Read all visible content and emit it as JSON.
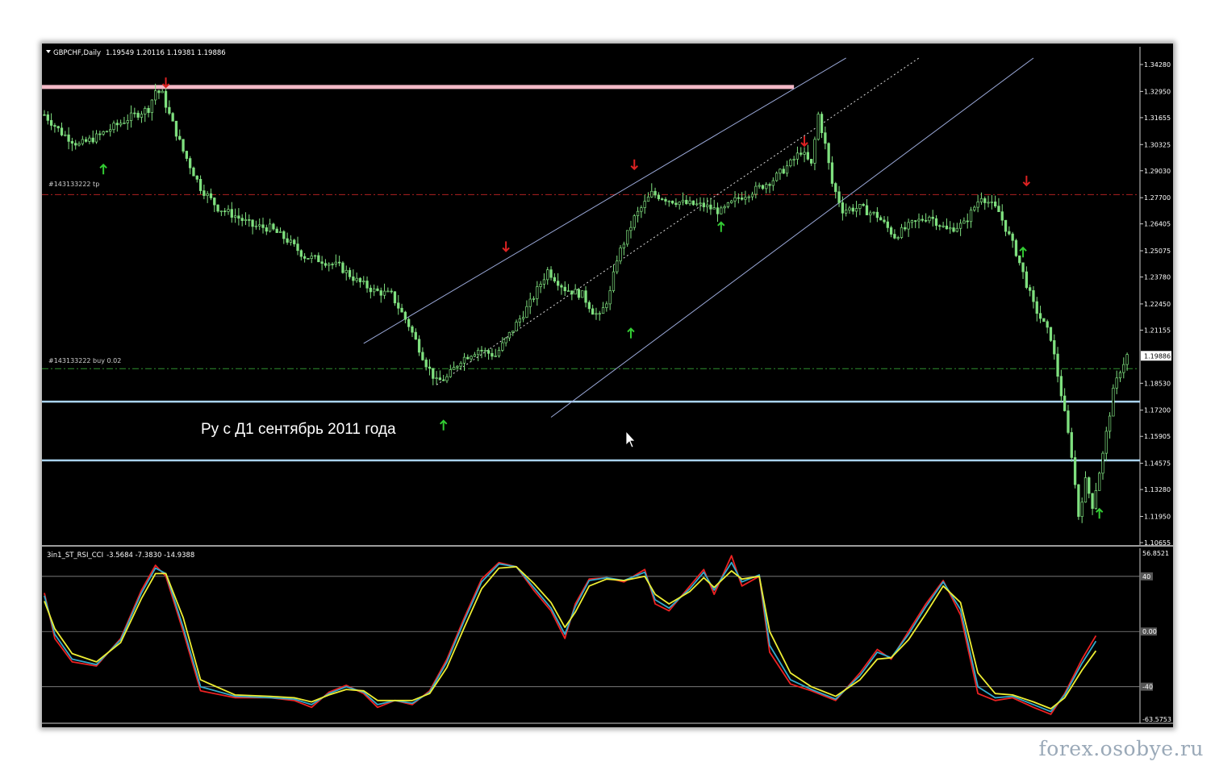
{
  "main_header": {
    "symbol": "GBPCHF,Daily",
    "ohlc": "1.19549 1.20116 1.19381 1.19886"
  },
  "indicator_header": {
    "name": "3in1_ST_RSI_CCI",
    "values": "-3.5684 -7.3830 -14.9388"
  },
  "annotation": "Ру с Д1 сентябрь 2011 года",
  "order_labels": {
    "tp": "#143133222 tp",
    "buy": "#143133222 buy 0.02"
  },
  "watermark": "forex.osobye.ru",
  "colors": {
    "candle": "#7fe07f",
    "resistance": "#f3b8c6",
    "support": "#a9d3f0",
    "channel": "#9aa8d8",
    "tp_line": "#b02020",
    "buy_line": "#2f8f2f",
    "arrow_up": "#33cc33",
    "arrow_down": "#dd2222"
  },
  "chart_data": [
    {
      "type": "line",
      "title": "GBPCHF,Daily",
      "ylim": [
        1.10655,
        1.3428
      ],
      "price_ticks": [
        "1.34280",
        "1.32950",
        "1.31655",
        "1.30325",
        "1.29030",
        "1.27700",
        "1.26405",
        "1.25075",
        "1.23780",
        "1.22450",
        "1.21155",
        "1.19886",
        "1.18530",
        "1.17200",
        "1.15905",
        "1.14575",
        "1.13280",
        "1.11950",
        "1.10655"
      ],
      "current_price": "1.19886",
      "close": [
        [
          0,
          1.318
        ],
        [
          5,
          1.309
        ],
        [
          10,
          1.303
        ],
        [
          15,
          1.307
        ],
        [
          20,
          1.312
        ],
        [
          25,
          1.317
        ],
        [
          30,
          1.321
        ],
        [
          32,
          1.33
        ],
        [
          34,
          1.328
        ],
        [
          36,
          1.318
        ],
        [
          40,
          1.3
        ],
        [
          45,
          1.282
        ],
        [
          50,
          1.272
        ],
        [
          55,
          1.268
        ],
        [
          60,
          1.263
        ],
        [
          65,
          1.262
        ],
        [
          70,
          1.256
        ],
        [
          75,
          1.248
        ],
        [
          80,
          1.246
        ],
        [
          85,
          1.243
        ],
        [
          90,
          1.236
        ],
        [
          95,
          1.231
        ],
        [
          100,
          1.229
        ],
        [
          105,
          1.214
        ],
        [
          110,
          1.195
        ],
        [
          113,
          1.186
        ],
        [
          116,
          1.188
        ],
        [
          120,
          1.197
        ],
        [
          125,
          1.202
        ],
        [
          130,
          1.199
        ],
        [
          135,
          1.212
        ],
        [
          140,
          1.225
        ],
        [
          145,
          1.241
        ],
        [
          150,
          1.232
        ],
        [
          155,
          1.229
        ],
        [
          158,
          1.221
        ],
        [
          160,
          1.218
        ],
        [
          163,
          1.23
        ],
        [
          165,
          1.247
        ],
        [
          170,
          1.267
        ],
        [
          175,
          1.279
        ],
        [
          180,
          1.276
        ],
        [
          185,
          1.274
        ],
        [
          190,
          1.273
        ],
        [
          195,
          1.27
        ],
        [
          200,
          1.277
        ],
        [
          205,
          1.281
        ],
        [
          210,
          1.286
        ],
        [
          215,
          1.294
        ],
        [
          218,
          1.3
        ],
        [
          221,
          1.293
        ],
        [
          223,
          1.318
        ],
        [
          225,
          1.303
        ],
        [
          227,
          1.284
        ],
        [
          230,
          1.271
        ],
        [
          235,
          1.272
        ],
        [
          240,
          1.268
        ],
        [
          245,
          1.258
        ],
        [
          250,
          1.264
        ],
        [
          255,
          1.268
        ],
        [
          260,
          1.261
        ],
        [
          265,
          1.264
        ],
        [
          270,
          1.278
        ],
        [
          275,
          1.27
        ],
        [
          280,
          1.25
        ],
        [
          285,
          1.224
        ],
        [
          290,
          1.208
        ],
        [
          293,
          1.18
        ],
        [
          296,
          1.15
        ],
        [
          298,
          1.12
        ],
        [
          300,
          1.137
        ],
        [
          302,
          1.125
        ],
        [
          305,
          1.15
        ],
        [
          308,
          1.181
        ],
        [
          310,
          1.192
        ],
        [
          312,
          1.199
        ]
      ],
      "resistance": 1.3317,
      "support": [
        1.1762,
        1.1472
      ],
      "tp_level": 1.2785,
      "buy_level": 1.1925,
      "channel": [
        {
          "style": "solid",
          "from": [
            92,
            1.205
          ],
          "to": [
            231,
            1.346
          ]
        },
        {
          "style": "dotted",
          "from": [
            113,
            1.1845
          ],
          "to": [
            252,
            1.346
          ]
        },
        {
          "style": "solid",
          "from": [
            146,
            1.1685
          ],
          "to": [
            285,
            1.346
          ]
        }
      ],
      "up_arrows": [
        [
          17,
          1.2905
        ],
        [
          115,
          1.164
        ],
        [
          195,
          1.262
        ],
        [
          169,
          1.2095
        ],
        [
          282,
          1.2495
        ],
        [
          304,
          1.1204
        ]
      ],
      "down_arrows": [
        [
          35,
          1.334
        ],
        [
          133,
          1.253
        ],
        [
          170,
          1.2935
        ],
        [
          219,
          1.305
        ],
        [
          283,
          1.2855
        ]
      ]
    },
    {
      "type": "line",
      "title": "3in1_ST_RSI_CCI",
      "ylim": [
        -63.5753,
        56.8521
      ],
      "value_ticks": [
        "56.8521",
        "40",
        "0.00",
        "-40",
        "-63.5753"
      ],
      "series": [
        {
          "name": "ST",
          "color": "#ee2222",
          "values": [
            [
              0,
              28
            ],
            [
              3,
              -5
            ],
            [
              8,
              -22
            ],
            [
              15,
              -25
            ],
            [
              22,
              -5
            ],
            [
              28,
              30
            ],
            [
              32,
              48
            ],
            [
              35,
              40
            ],
            [
              40,
              0
            ],
            [
              45,
              -43
            ],
            [
              55,
              -48
            ],
            [
              65,
              -48
            ],
            [
              72,
              -50
            ],
            [
              77,
              -55
            ],
            [
              82,
              -44
            ],
            [
              87,
              -39
            ],
            [
              92,
              -45
            ],
            [
              96,
              -55
            ],
            [
              101,
              -50
            ],
            [
              106,
              -53
            ],
            [
              111,
              -43
            ],
            [
              116,
              -20
            ],
            [
              121,
              10
            ],
            [
              126,
              38
            ],
            [
              131,
              50
            ],
            [
              136,
              47
            ],
            [
              141,
              30
            ],
            [
              146,
              15
            ],
            [
              150,
              -5
            ],
            [
              153,
              20
            ],
            [
              157,
              38
            ],
            [
              162,
              39
            ],
            [
              167,
              36
            ],
            [
              173,
              45
            ],
            [
              176,
              20
            ],
            [
              180,
              15
            ],
            [
              186,
              33
            ],
            [
              190,
              45
            ],
            [
              193,
              27
            ],
            [
              198,
              55
            ],
            [
              201,
              33
            ],
            [
              206,
              40
            ],
            [
              209,
              -15
            ],
            [
              215,
              -38
            ],
            [
              221,
              -43
            ],
            [
              228,
              -50
            ],
            [
              235,
              -30
            ],
            [
              240,
              -13
            ],
            [
              244,
              -20
            ],
            [
              249,
              0
            ],
            [
              254,
              20
            ],
            [
              259,
              37
            ],
            [
              264,
              12
            ],
            [
              269,
              -45
            ],
            [
              274,
              -50
            ],
            [
              279,
              -48
            ],
            [
              285,
              -55
            ],
            [
              290,
              -60
            ],
            [
              294,
              -45
            ],
            [
              299,
              -20
            ],
            [
              303,
              -3
            ]
          ]
        },
        {
          "name": "RSI",
          "color": "#33aacc",
          "values": [
            [
              0,
              26
            ],
            [
              3,
              -2
            ],
            [
              8,
              -20
            ],
            [
              15,
              -24
            ],
            [
              22,
              -6
            ],
            [
              28,
              28
            ],
            [
              32,
              46
            ],
            [
              35,
              42
            ],
            [
              40,
              3
            ],
            [
              45,
              -40
            ],
            [
              55,
              -47
            ],
            [
              65,
              -48
            ],
            [
              72,
              -49
            ],
            [
              77,
              -53
            ],
            [
              82,
              -45
            ],
            [
              87,
              -40
            ],
            [
              92,
              -44
            ],
            [
              96,
              -53
            ],
            [
              101,
              -50
            ],
            [
              106,
              -52
            ],
            [
              111,
              -44
            ],
            [
              116,
              -22
            ],
            [
              121,
              8
            ],
            [
              126,
              36
            ],
            [
              131,
              49
            ],
            [
              136,
              47
            ],
            [
              141,
              32
            ],
            [
              146,
              17
            ],
            [
              150,
              -2
            ],
            [
              153,
              18
            ],
            [
              157,
              37
            ],
            [
              162,
              39
            ],
            [
              167,
              37
            ],
            [
              173,
              43
            ],
            [
              176,
              23
            ],
            [
              180,
              17
            ],
            [
              186,
              31
            ],
            [
              190,
              43
            ],
            [
              193,
              30
            ],
            [
              198,
              50
            ],
            [
              201,
              36
            ],
            [
              206,
              41
            ],
            [
              209,
              -10
            ],
            [
              215,
              -35
            ],
            [
              221,
              -42
            ],
            [
              228,
              -49
            ],
            [
              235,
              -32
            ],
            [
              240,
              -15
            ],
            [
              244,
              -19
            ],
            [
              249,
              -2
            ],
            [
              254,
              18
            ],
            [
              259,
              36
            ],
            [
              264,
              16
            ],
            [
              269,
              -40
            ],
            [
              274,
              -48
            ],
            [
              279,
              -47
            ],
            [
              285,
              -53
            ],
            [
              290,
              -58
            ],
            [
              294,
              -46
            ],
            [
              299,
              -23
            ],
            [
              303,
              -7
            ]
          ]
        },
        {
          "name": "CCI",
          "color": "#eeee33",
          "values": [
            [
              0,
              22
            ],
            [
              3,
              2
            ],
            [
              8,
              -16
            ],
            [
              15,
              -22
            ],
            [
              22,
              -8
            ],
            [
              28,
              24
            ],
            [
              32,
              42
            ],
            [
              35,
              42
            ],
            [
              40,
              10
            ],
            [
              45,
              -35
            ],
            [
              55,
              -46
            ],
            [
              65,
              -47
            ],
            [
              72,
              -48
            ],
            [
              77,
              -51
            ],
            [
              82,
              -46
            ],
            [
              87,
              -42
            ],
            [
              92,
              -43
            ],
            [
              96,
              -50
            ],
            [
              101,
              -50
            ],
            [
              106,
              -50
            ],
            [
              111,
              -45
            ],
            [
              116,
              -26
            ],
            [
              121,
              3
            ],
            [
              126,
              31
            ],
            [
              131,
              46
            ],
            [
              136,
              47
            ],
            [
              141,
              35
            ],
            [
              146,
              21
            ],
            [
              150,
              3
            ],
            [
              153,
              14
            ],
            [
              157,
              33
            ],
            [
              162,
              38
            ],
            [
              167,
              37
            ],
            [
              173,
              40
            ],
            [
              176,
              27
            ],
            [
              180,
              20
            ],
            [
              186,
              29
            ],
            [
              190,
              39
            ],
            [
              193,
              32
            ],
            [
              198,
              44
            ],
            [
              201,
              38
            ],
            [
              206,
              40
            ],
            [
              209,
              0
            ],
            [
              215,
              -30
            ],
            [
              221,
              -40
            ],
            [
              228,
              -47
            ],
            [
              235,
              -35
            ],
            [
              240,
              -20
            ],
            [
              244,
              -19
            ],
            [
              249,
              -6
            ],
            [
              254,
              13
            ],
            [
              259,
              33
            ],
            [
              264,
              21
            ],
            [
              269,
              -30
            ],
            [
              274,
              -45
            ],
            [
              279,
              -46
            ],
            [
              285,
              -51
            ],
            [
              290,
              -56
            ],
            [
              294,
              -48
            ],
            [
              299,
              -28
            ],
            [
              303,
              -14
            ]
          ]
        }
      ]
    }
  ]
}
